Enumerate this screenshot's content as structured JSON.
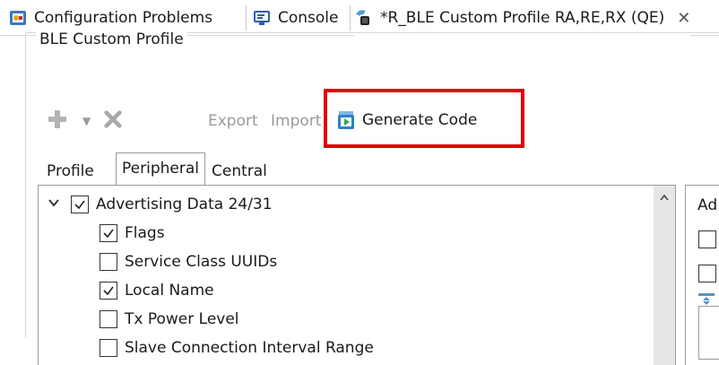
{
  "tabs": [
    {
      "label": "Configuration Problems",
      "icon": "config-problems-icon"
    },
    {
      "label": "Console",
      "icon": "console-icon"
    },
    {
      "label": "*R_BLE Custom Profile RA,RE,RX (QE)",
      "icon": "qe-ble-icon",
      "active": true
    }
  ],
  "editor": {
    "group_title": "BLE Custom Profile",
    "toolbar": {
      "export_label": "Export",
      "import_label": "Import",
      "generate_label": "Generate Code"
    },
    "subtabs": [
      "Profile",
      "Peripheral",
      "Central"
    ],
    "active_subtab": "Peripheral",
    "tree": [
      {
        "label": "Advertising Data 24/31",
        "checked": true,
        "expanded": true,
        "level": 0
      },
      {
        "label": "Flags",
        "checked": true,
        "level": 1
      },
      {
        "label": "Service Class UUIDs",
        "checked": false,
        "level": 1
      },
      {
        "label": "Local Name",
        "checked": true,
        "level": 1
      },
      {
        "label": "Tx Power Level",
        "checked": false,
        "level": 1
      },
      {
        "label": "Slave Connection Interval Range",
        "checked": false,
        "level": 1
      }
    ],
    "right_panel_title": "Ad"
  },
  "colors": {
    "highlight_box": "#e00000",
    "scrollbar": "#e6e6e6"
  }
}
